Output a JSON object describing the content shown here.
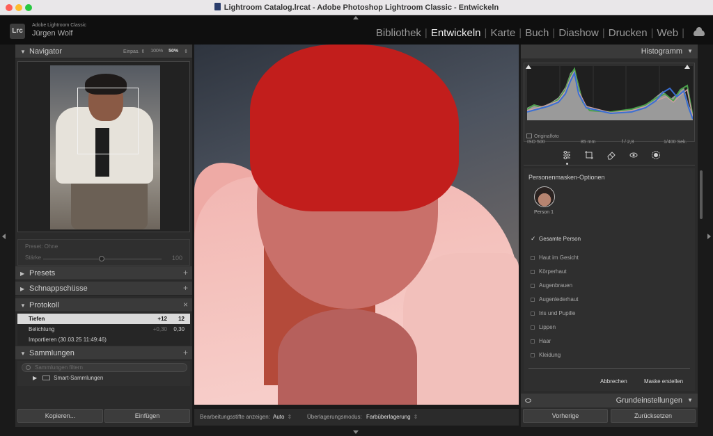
{
  "window": {
    "title": "Lightroom Catalog.lrcat - Adobe Photoshop Lightroom Classic - Entwickeln"
  },
  "identity": {
    "app": "Adobe Lightroom Classic",
    "user": "Jürgen Wolf",
    "logo": "Lrc"
  },
  "modules": [
    {
      "label": "Bibliothek",
      "active": false
    },
    {
      "label": "Entwickeln",
      "active": true
    },
    {
      "label": "Karte",
      "active": false
    },
    {
      "label": "Buch",
      "active": false
    },
    {
      "label": "Diashow",
      "active": false
    },
    {
      "label": "Drucken",
      "active": false
    },
    {
      "label": "Web",
      "active": false
    }
  ],
  "left": {
    "navigator": {
      "title": "Navigator",
      "opt_fit": "Einpas. ⇕",
      "opt_100": "100%",
      "opt_50": "50%",
      "opt_more": "⇕"
    },
    "preset": {
      "label": "Preset: Ohne",
      "strength_label": "Stärke",
      "strength_value": "100"
    },
    "presets_title": "Presets",
    "snapshots_title": "Schnappschüsse",
    "history": {
      "title": "Protokoll",
      "items": [
        {
          "name": "Tiefen",
          "a": "+12",
          "b": "12",
          "selected": true
        },
        {
          "name": "Belichtung",
          "a": "+0,30",
          "b": "0,30",
          "selected": false
        },
        {
          "name": "Importieren (30.03.25 11:49:46)",
          "a": "",
          "b": "",
          "selected": false
        }
      ]
    },
    "collections": {
      "title": "Sammlungen",
      "search_placeholder": "Sammlungen filtern",
      "smart": "Smart-Sammlungen"
    },
    "buttons": {
      "copy": "Kopieren...",
      "paste": "Einfügen"
    }
  },
  "toolbar": {
    "pins_label": "Bearbeitungsstifte anzeigen:",
    "pins_value": "Auto",
    "overlay_label": "Überlagerungsmodus:",
    "overlay_value": "Farbüberlagerung"
  },
  "right": {
    "histogram": {
      "title": "Histogramm",
      "iso": "ISO 500",
      "focal": "85 mm",
      "aperture": "f / 2,8",
      "shutter": "1/400 Sek.",
      "original": "Originalfoto"
    },
    "mask": {
      "title": "Personenmasken-Optionen",
      "person": "Person 1",
      "whole": "Gesamte Person",
      "options": [
        "Haut im Gesicht",
        "Körperhaut",
        "Augenbrauen",
        "Augenlederhaut",
        "Iris und Pupille",
        "Lippen",
        "Haar",
        "Kleidung"
      ],
      "cancel": "Abbrechen",
      "create": "Maske erstellen"
    },
    "basic_title": "Grundeinstellungen",
    "buttons": {
      "previous": "Vorherige",
      "reset": "Zurücksetzen"
    }
  }
}
